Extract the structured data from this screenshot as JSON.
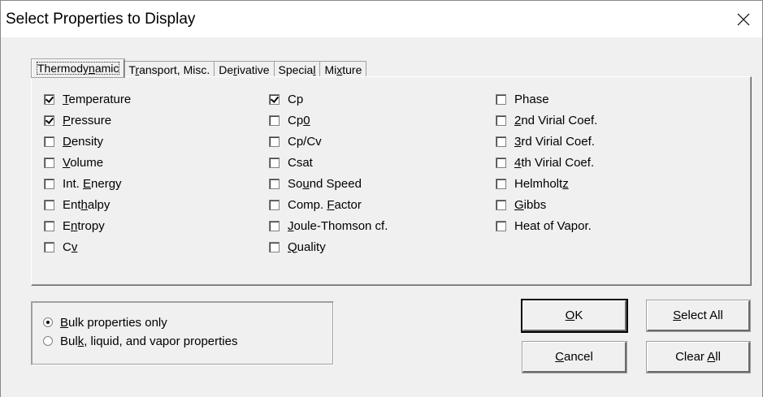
{
  "window": {
    "title": "Select Properties to Display",
    "close_icon": "close-icon"
  },
  "tabs": [
    {
      "pre": "Thermody",
      "acc": "n",
      "post": "amic",
      "active": true
    },
    {
      "pre": "T",
      "acc": "r",
      "post": "ansport, Misc.",
      "active": false
    },
    {
      "pre": "De",
      "acc": "r",
      "post": "ivative",
      "active": false
    },
    {
      "pre": "Specia",
      "acc": "l",
      "post": "",
      "active": false
    },
    {
      "pre": "Mi",
      "acc": "x",
      "post": "ture",
      "active": false
    }
  ],
  "columns": [
    [
      {
        "pre": "",
        "acc": "T",
        "post": "emperature",
        "checked": true
      },
      {
        "pre": "",
        "acc": "P",
        "post": "ressure",
        "checked": true
      },
      {
        "pre": "",
        "acc": "D",
        "post": "ensity",
        "checked": false
      },
      {
        "pre": "",
        "acc": "V",
        "post": "olume",
        "checked": false
      },
      {
        "pre": "Int. ",
        "acc": "E",
        "post": "nergy",
        "checked": false
      },
      {
        "pre": "Ent",
        "acc": "h",
        "post": "alpy",
        "checked": false
      },
      {
        "pre": "E",
        "acc": "n",
        "post": "tropy",
        "checked": false
      },
      {
        "pre": "C",
        "acc": "v",
        "post": "",
        "checked": false
      }
    ],
    [
      {
        "pre": "Cp",
        "acc": "",
        "post": "",
        "checked": true
      },
      {
        "pre": "Cp",
        "acc": "0",
        "post": "",
        "checked": false
      },
      {
        "pre": "Cp/Cv",
        "acc": "",
        "post": "",
        "checked": false
      },
      {
        "pre": "Csat",
        "acc": "",
        "post": "",
        "checked": false
      },
      {
        "pre": "So",
        "acc": "u",
        "post": "nd Speed",
        "checked": false
      },
      {
        "pre": "Comp. ",
        "acc": "F",
        "post": "actor",
        "checked": false
      },
      {
        "pre": "",
        "acc": "J",
        "post": "oule-Thomson cf.",
        "checked": false
      },
      {
        "pre": "",
        "acc": "Q",
        "post": "uality",
        "checked": false
      }
    ],
    [
      {
        "pre": "Phase",
        "acc": "",
        "post": "",
        "checked": false
      },
      {
        "pre": "",
        "acc": "2",
        "post": "nd Virial Coef.",
        "checked": false
      },
      {
        "pre": "",
        "acc": "3",
        "post": "rd Virial Coef.",
        "checked": false
      },
      {
        "pre": "",
        "acc": "4",
        "post": "th Virial Coef.",
        "checked": false
      },
      {
        "pre": "Helmholt",
        "acc": "z",
        "post": "",
        "checked": false
      },
      {
        "pre": "",
        "acc": "G",
        "post": "ibbs",
        "checked": false
      },
      {
        "pre": "Heat of Vapor.",
        "acc": "",
        "post": "",
        "checked": false
      }
    ]
  ],
  "radios": [
    {
      "pre": "",
      "acc": "B",
      "post": "ulk properties only",
      "checked": true
    },
    {
      "pre": "Bul",
      "acc": "k",
      "post": ", liquid, and vapor properties",
      "checked": false
    }
  ],
  "buttons": {
    "ok": {
      "pre": "",
      "acc": "O",
      "post": "K"
    },
    "select_all": {
      "pre": "",
      "acc": "S",
      "post": "elect All"
    },
    "cancel": {
      "pre": "",
      "acc": "C",
      "post": "ancel"
    },
    "clear_all": {
      "pre": "Clear ",
      "acc": "A",
      "post": "ll"
    }
  }
}
